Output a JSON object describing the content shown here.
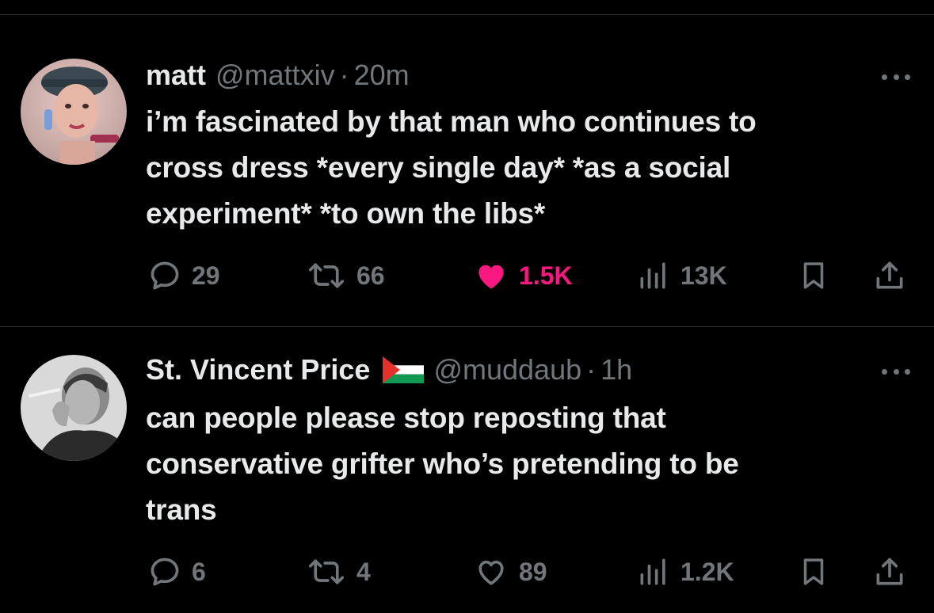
{
  "tweets": [
    {
      "name": "matt",
      "handle": "@mattxiv",
      "separator": "·",
      "time": "20m",
      "text_lines": [
        "i’m fascinated by that man who continues to",
        "cross dress *every single day* *as a social",
        "experiment* *to own the libs*"
      ],
      "replies": "29",
      "reposts": "66",
      "likes": "1.5K",
      "liked": true,
      "views": "13K"
    },
    {
      "name": "St. Vincent Price",
      "flag": "palestine-flag",
      "handle": "@muddaub",
      "separator": "·",
      "time": "1h",
      "text_lines": [
        "can people please stop reposting that",
        "conservative grifter who’s pretending to be",
        "trans"
      ],
      "replies": "6",
      "reposts": "4",
      "likes": "89",
      "liked": false,
      "views": "1.2K"
    }
  ],
  "colors": {
    "background": "#000000",
    "text_primary": "#e7e9ea",
    "text_secondary": "#71767b",
    "like_active": "#f91880",
    "divider": "#2f3336"
  },
  "icons": [
    "reply-icon",
    "repost-icon",
    "like-icon",
    "views-icon",
    "bookmark-icon",
    "share-icon",
    "more-icon"
  ]
}
